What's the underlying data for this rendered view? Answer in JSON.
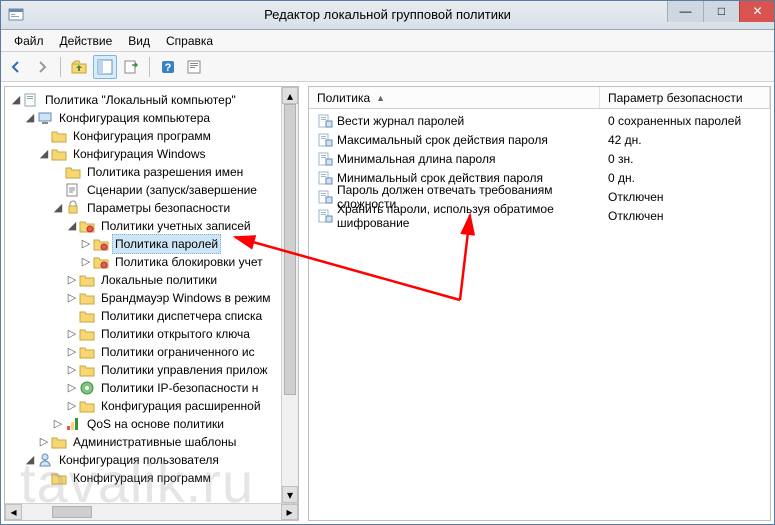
{
  "window": {
    "title": "Редактор локальной групповой политики",
    "minimize": "—",
    "maximize": "□",
    "close": "✕"
  },
  "menu": {
    "file": "Файл",
    "action": "Действие",
    "view": "Вид",
    "help": "Справка"
  },
  "tree": {
    "root": "Политика \"Локальный компьютер\"",
    "cc": "Конфигурация компьютера",
    "cp": "Конфигурация программ",
    "cw": "Конфигурация Windows",
    "pri": "Политика разрешения имен",
    "szz": "Сценарии (запуск/завершение",
    "pb": "Параметры безопасности",
    "puz": "Политики учетных записей",
    "pp": "Политика паролей",
    "pbu": "Политика блокировки учет",
    "lp": "Локальные политики",
    "bw": "Брандмауэр Windows в режим",
    "pds": "Политики диспетчера списка",
    "pok": "Политики открытого ключа",
    "poi": "Политики ограниченного ис",
    "pup": "Политики управления прилож",
    "pib": "Политики IP-безопасности н",
    "krp": "Конфигурация расширенной",
    "qos": "QoS на основе политики",
    "as": "Административные шаблоны",
    "cu": "Конфигурация пользователя",
    "cp2": "Конфигурация программ"
  },
  "columns": {
    "policy": "Политика",
    "secparam": "Параметр безопасности"
  },
  "rows": [
    {
      "name": "Вести журнал паролей",
      "value": "0 сохраненных паролей"
    },
    {
      "name": "Максимальный срок действия пароля",
      "value": "42 дн."
    },
    {
      "name": "Минимальная длина пароля",
      "value": "0 зн."
    },
    {
      "name": "Минимальный срок действия пароля",
      "value": "0 дн."
    },
    {
      "name": "Пароль должен отвечать требованиям сложности",
      "value": "Отключен"
    },
    {
      "name": "Хранить пароли, используя обратимое шифрование",
      "value": "Отключен"
    }
  ],
  "watermark": "tavalik.ru"
}
